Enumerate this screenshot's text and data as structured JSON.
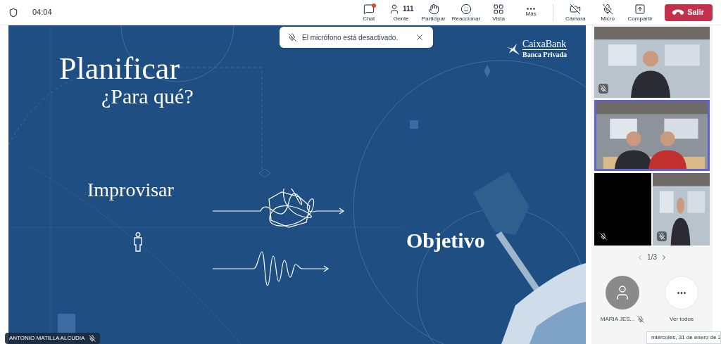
{
  "top_bar": {
    "timer": "04:04",
    "controls": [
      {
        "kind": "chat",
        "label": "Chat",
        "dot": true
      },
      {
        "kind": "people",
        "label": "Gente",
        "count": "111",
        "dot": false
      },
      {
        "kind": "hand",
        "label": "Participar",
        "dot": false
      },
      {
        "kind": "react",
        "label": "Reaccionar",
        "dot": false
      },
      {
        "kind": "view",
        "label": "Vista",
        "dot": false
      },
      {
        "kind": "more",
        "label": "Más",
        "dot": false
      },
      {
        "kind": "camera",
        "label": "Cámara",
        "dot": false
      },
      {
        "kind": "mic",
        "label": "Micro",
        "dot": false
      },
      {
        "kind": "share",
        "label": "Compartir",
        "dot": false
      }
    ],
    "leave": "Salir"
  },
  "slide": {
    "title": "Planificar",
    "subtitle": "¿Para qué?",
    "left_label": "Improvisar",
    "right_label": "Objetivo",
    "brand": "CaixaBank",
    "brand_sub": "Banca Privada"
  },
  "notification": "El micrófono está desactivado.",
  "presenter": {
    "name": "ANTONIO MATILLA ALCUDIA",
    "muted": true
  },
  "videos": [
    {
      "kind": "single",
      "selected": false,
      "muted": true
    },
    {
      "kind": "pair",
      "selected": true,
      "muted": false
    },
    {
      "kind": "off",
      "selected": false,
      "muted": true
    },
    {
      "kind": "single",
      "selected": false,
      "muted": true
    }
  ],
  "pager": "1/3",
  "participants": [
    {
      "kind": "avatar",
      "name": "MARIA JES...",
      "muted": true
    },
    {
      "kind": "more",
      "name": "Ver todos",
      "muted": false
    }
  ],
  "tooltip": "miércoles, 31 de enero de 2"
}
